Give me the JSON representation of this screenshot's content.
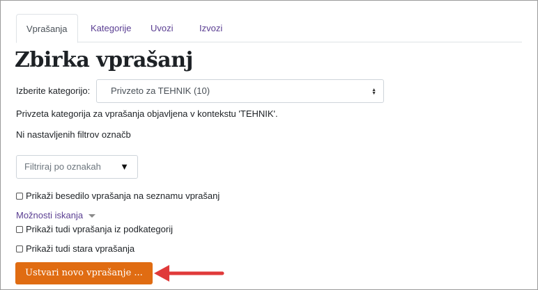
{
  "tabs": [
    {
      "label": "Vprašanja",
      "active": true
    },
    {
      "label": "Kategorije",
      "active": false
    },
    {
      "label": "Uvozi",
      "active": false
    },
    {
      "label": "Izvozi",
      "active": false
    }
  ],
  "page_title": "Zbirka vprašanj",
  "category": {
    "label": "Izberite kategorijo:",
    "selected": "Privzeto za TEHNIK (10)"
  },
  "info": {
    "description": "Privzeta kategorija za vprašanja objavljena v kontekstu 'TEHNIK'.",
    "no_filters": "Ni nastavljenih filtrov označb"
  },
  "tag_filter": {
    "placeholder": "Filtriraj po oznakah"
  },
  "options": {
    "show_question_text": {
      "label": "Prikaži besedilo vprašanja na seznamu vprašanj",
      "checked": false
    },
    "search_options_label": "Možnosti iskanja",
    "include_subcategories": {
      "label": "Prikaži tudi vprašanja iz podkategorij",
      "checked": false
    },
    "include_old": {
      "label": "Prikaži tudi stara vprašanja",
      "checked": false
    }
  },
  "create_button": {
    "label": "Ustvari novo vprašanje ..."
  },
  "colors": {
    "accent_button": "#e06c12",
    "annotation_arrow": "#e03a3a",
    "link": "#5a3e92"
  },
  "icons": {
    "select_sort": "sort-icon",
    "filter_caret": "caret-down-icon",
    "options_chevron": "chevron-down-icon",
    "annotation": "arrow-left-icon"
  }
}
